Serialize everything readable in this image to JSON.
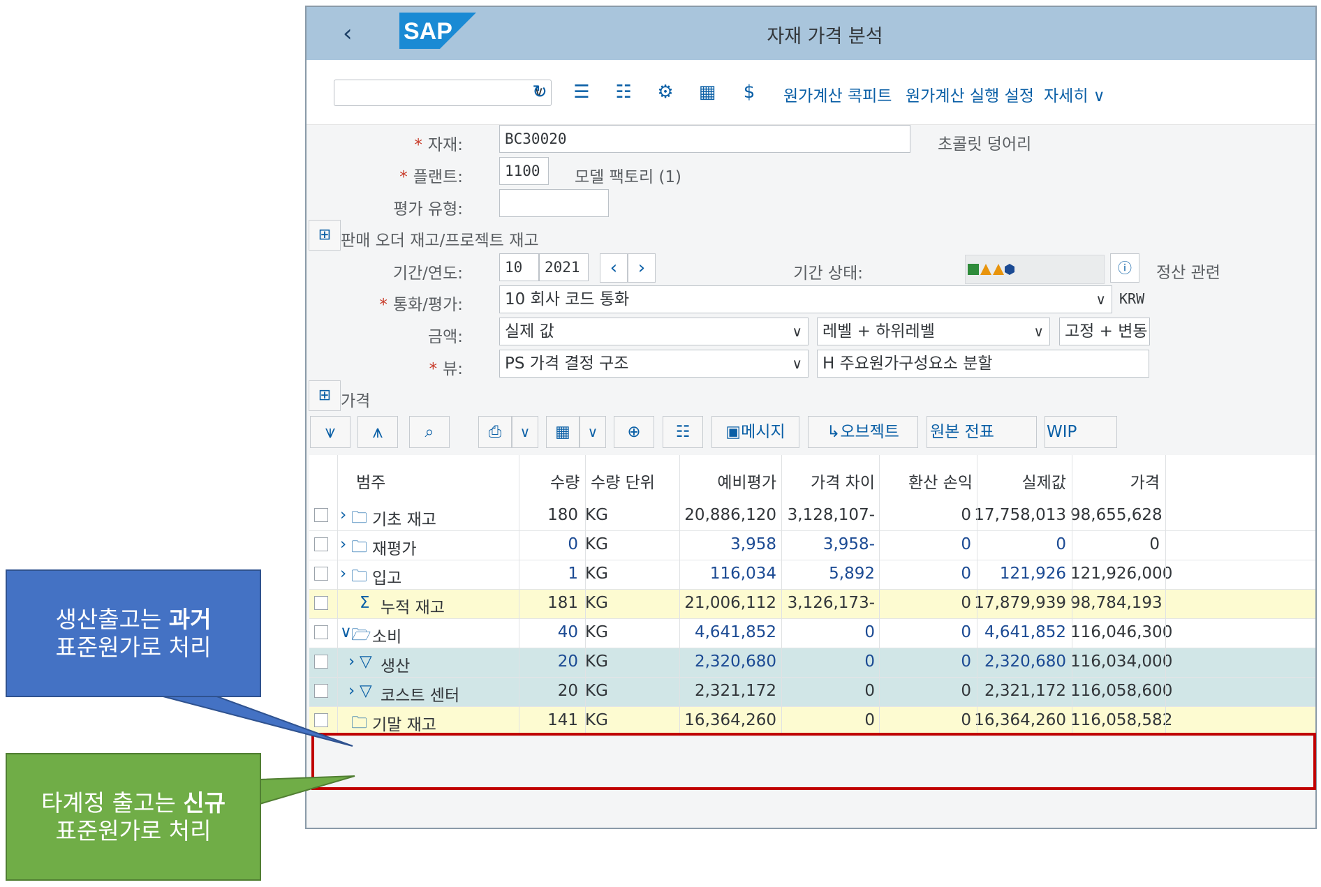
{
  "shell": {
    "title": "자재 가격 분석",
    "logo_text": "SAP"
  },
  "toolbar": {
    "variant_value": "",
    "links": [
      "원가계산 콕피트",
      "원가계산 실행 설정",
      "자세히"
    ]
  },
  "form": {
    "material_label": "자재:",
    "material_value": "BC30020",
    "material_desc": "초콜릿 덩어리",
    "plant_label": "플랜트:",
    "plant_value": "1100",
    "plant_desc": "모델 팩토리 (1)",
    "valuation_label": "평가 유형:",
    "valuation_value": "",
    "sales_order_label": "판매 오더 재고/프로젝트 재고",
    "period_label": "기간/연도:",
    "period_value": "10",
    "year_value": "2021",
    "period_status_label": "기간 상태:",
    "settlement_label": "정산 관련",
    "currency_label": "통화/평가:",
    "currency_value": "10 회사 코드 통화",
    "currency_code": "KRW",
    "amount_label": "금액:",
    "amount_value": "실제 값",
    "level_value": "레벨 + 하위레벨",
    "fixvar_value": "고정 + 변동",
    "view_label": "뷰:",
    "view_value": "PS 가격 결정 구조",
    "split_value": "H 주요원가구성요소 분할",
    "price_section_label": "가격"
  },
  "table_toolbar": {
    "messages": "메시지",
    "objects": "오브젝트",
    "source_doc": "원본 전표",
    "wip": "WIP"
  },
  "table": {
    "headers": [
      "범주",
      "수량",
      "수량 단위",
      "예비평가",
      "가격 차이",
      "환산 손익",
      "실제값",
      "가격"
    ],
    "rows": [
      {
        "category": "기초 재고",
        "qty": "180",
        "unit": "KG",
        "prelim": "20,886,120",
        "diff": "3,128,107-",
        "fx": "0",
        "actual": "17,758,013",
        "price": "98,655,628"
      },
      {
        "category": "재평가",
        "qty": "0",
        "unit": "KG",
        "prelim": "3,958",
        "diff": "3,958-",
        "fx": "0",
        "actual": "0",
        "price": "0"
      },
      {
        "category": "입고",
        "qty": "1",
        "unit": "KG",
        "prelim": "116,034",
        "diff": "5,892",
        "fx": "0",
        "actual": "121,926",
        "price": "121,926,000"
      },
      {
        "category": "누적 재고",
        "qty": "181",
        "unit": "KG",
        "prelim": "21,006,112",
        "diff": "3,126,173-",
        "fx": "0",
        "actual": "17,879,939",
        "price": "98,784,193"
      },
      {
        "category": "소비",
        "qty": "40",
        "unit": "KG",
        "prelim": "4,641,852",
        "diff": "0",
        "fx": "0",
        "actual": "4,641,852",
        "price": "116,046,300"
      },
      {
        "category": "생산",
        "qty": "20",
        "unit": "KG",
        "prelim": "2,320,680",
        "diff": "0",
        "fx": "0",
        "actual": "2,320,680",
        "price": "116,034,000"
      },
      {
        "category": "코스트 센터",
        "qty": "20",
        "unit": "KG",
        "prelim": "2,321,172",
        "diff": "0",
        "fx": "0",
        "actual": "2,321,172",
        "price": "116,058,600"
      },
      {
        "category": "기말 재고",
        "qty": "141",
        "unit": "KG",
        "prelim": "16,364,260",
        "diff": "0",
        "fx": "0",
        "actual": "16,364,260",
        "price": "116,058,582"
      }
    ]
  },
  "callouts": {
    "blue_line1_pre": "생산출고는 ",
    "blue_line1_bold": "과거",
    "blue_line2": "표준원가로 처리",
    "green_line1_pre": "타계정 출고는 ",
    "green_line1_bold": "신규",
    "green_line2": "표준원가로 처리"
  },
  "colors": {
    "shell": "#a9c5dc",
    "accent": "#0a5fa6",
    "highlight_border": "#c00000",
    "callout_blue": "#4472c4",
    "callout_green": "#70ad47"
  }
}
